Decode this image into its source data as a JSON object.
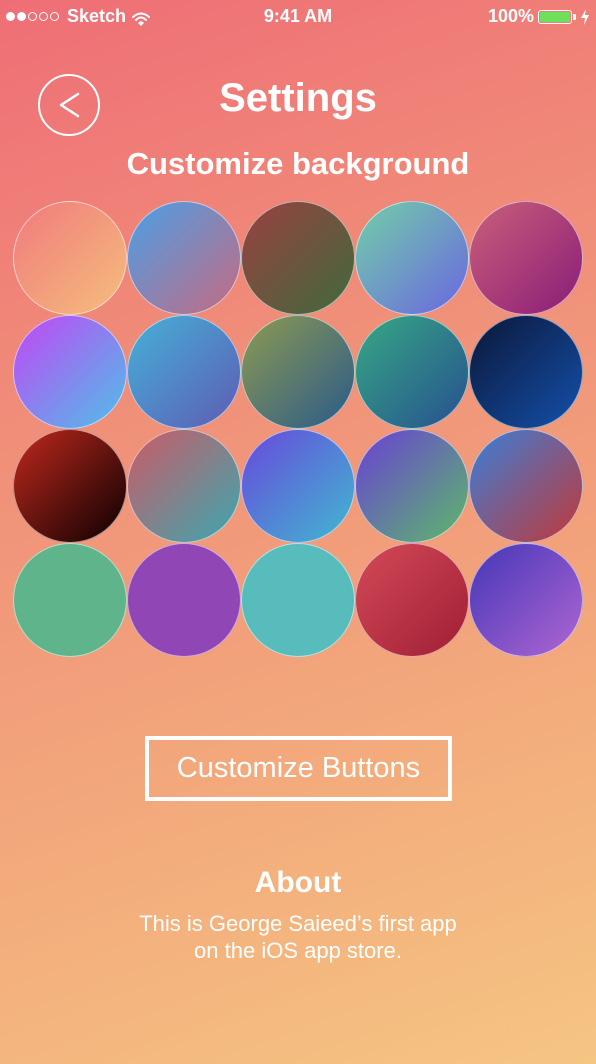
{
  "status_bar": {
    "signal_filled": 2,
    "signal_total": 5,
    "carrier": "Sketch",
    "wifi_icon": "wifi-icon",
    "time": "9:41 AM",
    "battery_percent": "100%",
    "battery_level": 1.0,
    "battery_icon": "battery-icon",
    "charging_icon": "charging-bolt-icon"
  },
  "header": {
    "back_icon": "chevron-left-icon",
    "title": "Settings"
  },
  "background_section": {
    "title": "Customize background",
    "swatches": [
      {
        "from": "#f07a7d",
        "to": "#f5be7c"
      },
      {
        "from": "#4a9fe6",
        "to": "#c66a82"
      },
      {
        "from": "#9a4040",
        "to": "#3f6a3c"
      },
      {
        "from": "#72cfa8",
        "to": "#6a66e0"
      },
      {
        "from": "#c9607a",
        "to": "#8a1c78"
      },
      {
        "from": "#c246f5",
        "to": "#4ec0e8"
      },
      {
        "from": "#45b0d8",
        "to": "#5e5cb4"
      },
      {
        "from": "#8d9a50",
        "to": "#2a5a8a"
      },
      {
        "from": "#36a884",
        "to": "#27508f"
      },
      {
        "from": "#0b1738",
        "to": "#1450ab"
      },
      {
        "from": "#c0281e",
        "to": "#0a0000"
      },
      {
        "from": "#cc5a66",
        "to": "#3aa8b0"
      },
      {
        "from": "#6848dc",
        "to": "#40b8d0"
      },
      {
        "from": "#6a40d6",
        "to": "#5cb86a"
      },
      {
        "from": "#3a7ed8",
        "to": "#c23838"
      },
      {
        "from": "#5fb48c",
        "to": "#5fb48c"
      },
      {
        "from": "#9146b5",
        "to": "#9146b5"
      },
      {
        "from": "#58bcbd",
        "to": "#58bcbd"
      },
      {
        "from": "#d34a58",
        "to": "#a01e34"
      },
      {
        "from": "#4436b8",
        "to": "#b066d2"
      }
    ]
  },
  "customize_buttons": {
    "label": "Customize Buttons"
  },
  "about": {
    "title": "About",
    "line1": "This is George Saieed’s first app",
    "line2": "on the iOS app store."
  }
}
